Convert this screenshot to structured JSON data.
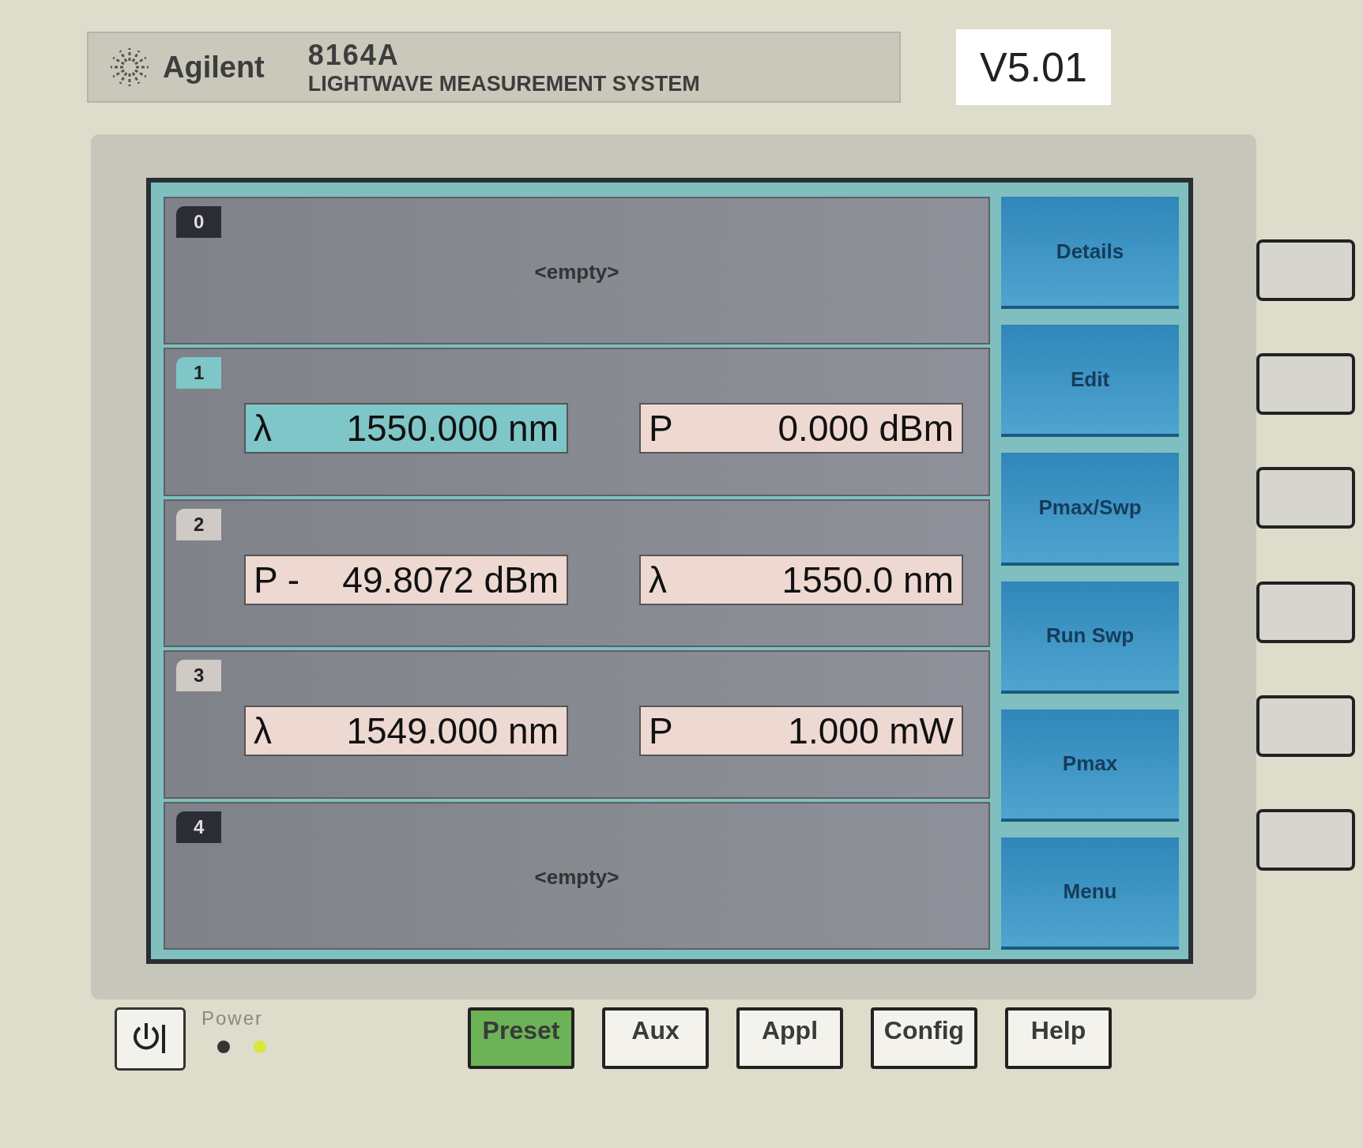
{
  "header": {
    "brand": "Agilent",
    "model": "8164A",
    "subtitle": "LIGHTWAVE MEASUREMENT SYSTEM",
    "version": "V5.01"
  },
  "slots": [
    {
      "number": "0",
      "selected": false,
      "empty_text": "<empty>"
    },
    {
      "number": "1",
      "selected": true,
      "fields": [
        {
          "symbol": "λ",
          "value": "1550.000 nm",
          "selected": true
        },
        {
          "symbol": "P",
          "value": "0.000 dBm",
          "selected": false
        }
      ]
    },
    {
      "number": "2",
      "selected": false,
      "fields": [
        {
          "symbol": "P -",
          "value": "49.8072 dBm",
          "selected": false
        },
        {
          "symbol": "λ",
          "value": "1550.0 nm",
          "selected": false
        }
      ]
    },
    {
      "number": "3",
      "selected": false,
      "fields": [
        {
          "symbol": "λ",
          "value": "1549.000 nm",
          "selected": false
        },
        {
          "symbol": "P",
          "value": "1.000 mW",
          "selected": false
        }
      ]
    },
    {
      "number": "4",
      "selected": false,
      "empty_text": "<empty>"
    }
  ],
  "softkeys": [
    "Details",
    "Edit",
    "Pmax/Swp",
    "Run Swp",
    "Pmax",
    "Menu"
  ],
  "power": {
    "label": "Power",
    "leds": [
      {
        "on": false
      },
      {
        "on": true
      }
    ]
  },
  "front_buttons": [
    {
      "label": "Preset",
      "lit": true
    },
    {
      "label": "Aux",
      "lit": false
    },
    {
      "label": "Appl",
      "lit": false
    },
    {
      "label": "Config",
      "lit": false
    },
    {
      "label": "Help",
      "lit": false
    }
  ]
}
